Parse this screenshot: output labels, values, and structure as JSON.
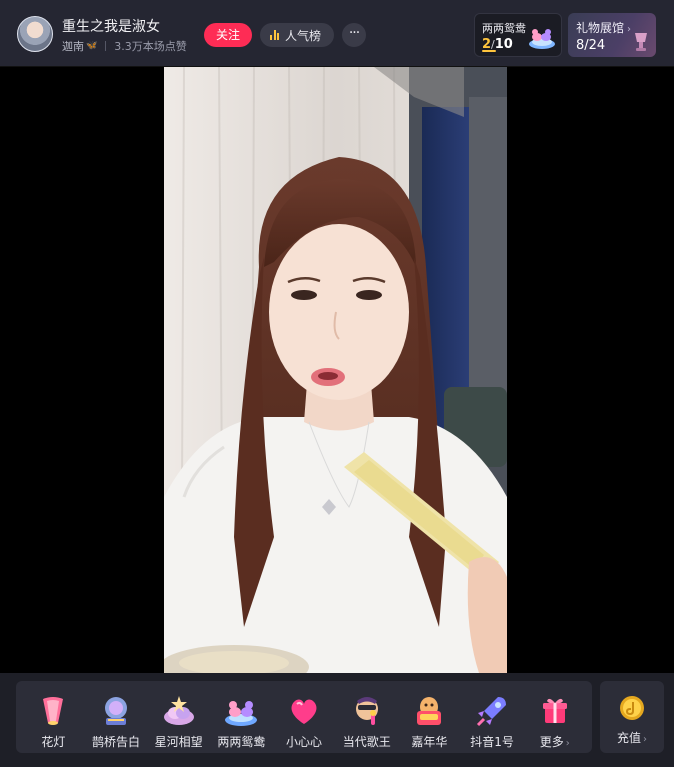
{
  "header": {
    "streamer_name": "重生之我是淑女",
    "region": "迦南",
    "likes_text": "3.3万本场点赞",
    "follow_label": "关注",
    "rank_label": "人气榜",
    "more_label": "···"
  },
  "gift_task": {
    "title": "两两鸳鸯",
    "current": "2",
    "total": "10"
  },
  "gift_gallery": {
    "title": "礼物展馆",
    "chevron": "›",
    "count": "8/24"
  },
  "gifts": [
    {
      "label": "花灯",
      "icon": "lantern-icon"
    },
    {
      "label": "鹊桥告白",
      "icon": "bridge-globe-icon"
    },
    {
      "label": "星河相望",
      "icon": "star-river-icon"
    },
    {
      "label": "两两鸳鸯",
      "icon": "ducks-icon"
    },
    {
      "label": "小心心",
      "icon": "heart-icon"
    },
    {
      "label": "当代歌王",
      "icon": "singer-icon"
    },
    {
      "label": "嘉年华",
      "icon": "carnival-icon"
    },
    {
      "label": "抖音1号",
      "icon": "rocket-icon"
    },
    {
      "label": "更多",
      "icon": "gift-box-icon"
    }
  ],
  "recharge": {
    "label": "充值",
    "icon": "coin-icon"
  },
  "chevron": "›",
  "colors": {
    "follow": "#fe2c55",
    "accent_yellow": "#ffc53d",
    "header_bg": "#252632",
    "gift_bar_bg": "#1e1f27"
  }
}
